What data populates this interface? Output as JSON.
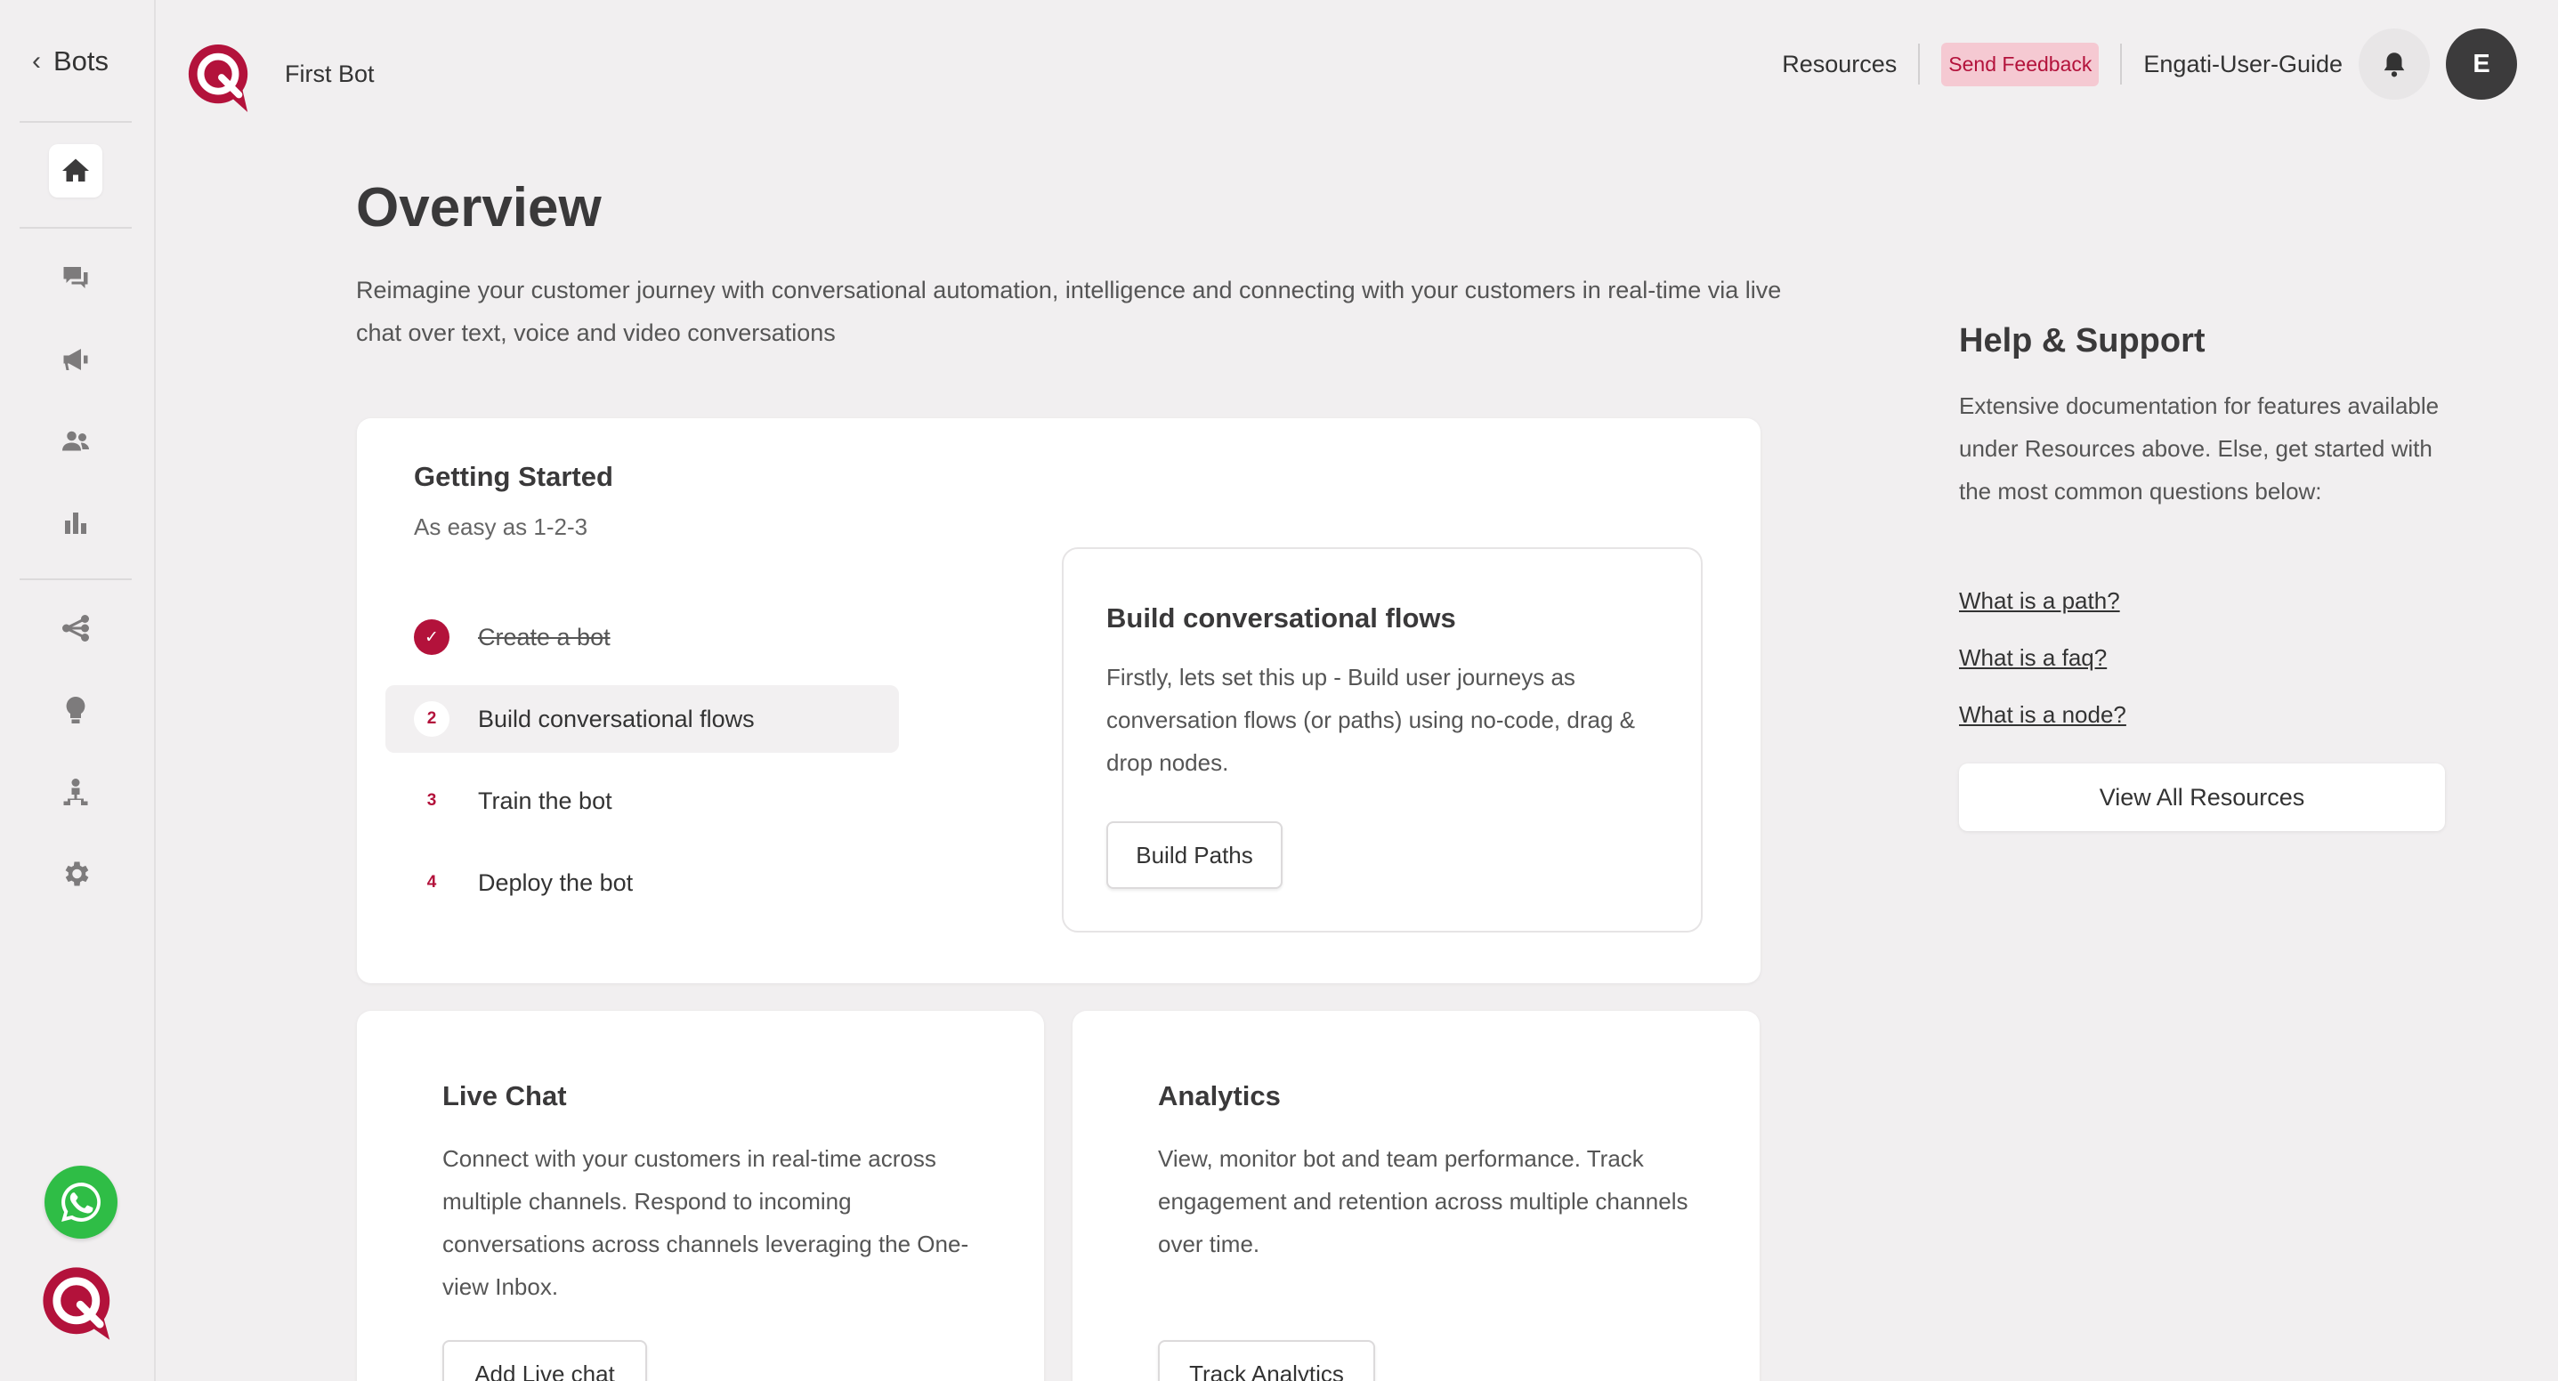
{
  "nav": {
    "back_label": "Bots",
    "items": [
      {
        "icon": "home-icon",
        "active": true
      },
      {
        "icon": "chat-icon"
      },
      {
        "icon": "megaphone-icon"
      },
      {
        "icon": "users-icon"
      },
      {
        "icon": "bar-chart-icon"
      },
      {
        "icon": "flow-icon"
      },
      {
        "icon": "bulb-icon"
      },
      {
        "icon": "org-chart-icon"
      },
      {
        "icon": "gear-icon"
      }
    ]
  },
  "header": {
    "bot_name": "First Bot",
    "resources": "Resources",
    "send_feedback": "Send Feedback",
    "user_guide": "Engati-User-Guide",
    "avatar_initial": "E"
  },
  "overview": {
    "title": "Overview",
    "description": "Reimagine your customer journey with conversational automation, intelligence and connecting with your customers in real-time via live chat over text, voice and video conversations"
  },
  "getting_started": {
    "title": "Getting Started",
    "subtitle": "As easy as 1-2-3",
    "steps": [
      {
        "num": "✓",
        "label": "Create a bot",
        "done": true
      },
      {
        "num": "2",
        "label": "Build conversational flows",
        "active": true
      },
      {
        "num": "3",
        "label": "Train the bot"
      },
      {
        "num": "4",
        "label": "Deploy the bot"
      }
    ],
    "detail": {
      "title": "Build conversational flows",
      "description": "Firstly, lets set this up - Build user journeys as conversation flows (or paths) using no-code, drag & drop nodes.",
      "button": "Build Paths"
    }
  },
  "live_chat": {
    "title": "Live Chat",
    "description": "Connect with your customers in real-time across multiple channels. Respond to incoming conversations across channels leveraging the One-view Inbox.",
    "button": "Add Live chat"
  },
  "analytics": {
    "title": "Analytics",
    "description": "View, monitor bot and team performance. Track engagement and retention across multiple channels over time.",
    "button": "Track Analytics"
  },
  "help": {
    "title": "Help & Support",
    "description": "Extensive documentation for features available under Resources above. Else, get started with the most common questions below:",
    "links": [
      "What is a path?",
      "What is a faq?",
      "What is a node?"
    ],
    "view_all": "View All Resources"
  },
  "colors": {
    "brand": "#b3123b",
    "background": "#f1eff0",
    "feedback_bg": "#f5c9d2",
    "whatsapp": "#2fbd46"
  }
}
